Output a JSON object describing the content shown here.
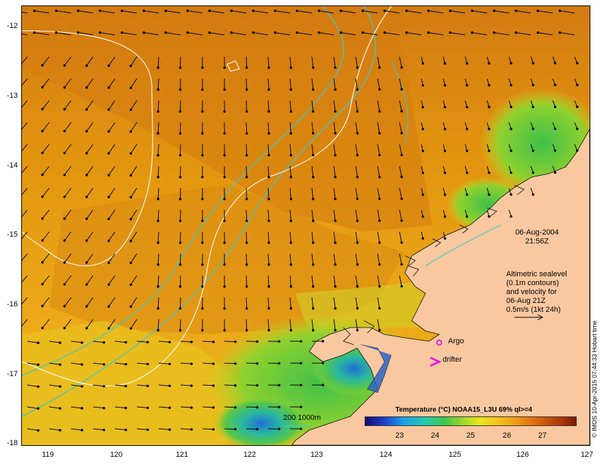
{
  "map": {
    "date": "06-Aug-2004",
    "time": "21:56Z",
    "info_lines": [
      "Altimetric sealevel",
      "(0.1m contours)",
      "and velocity for",
      "06-Aug 21Z",
      "0.5m/s (1kt 24h)"
    ],
    "lat_labels": [
      "-12",
      "-13",
      "-14",
      "-15",
      "-16",
      "-17",
      "-18"
    ],
    "lon_labels": [
      "119",
      "120",
      "121",
      "122",
      "123",
      "124",
      "125",
      "126",
      "127"
    ],
    "argo_label": "Argo",
    "drifter_label": "drifter",
    "depth_contours_label": "200  1000m",
    "copyright": "© IMOS 10-Apr-2015 07:44:33 Hobart time"
  },
  "legend": {
    "title": "Temperature (°C) NOAA15_L3U 69% ql>=4",
    "ticks": [
      "23",
      "24",
      "25",
      "26",
      "27"
    ]
  },
  "colors": {
    "land": "#f9c8a0",
    "warm_sea": "#dd8a14",
    "mid_sea": "#e9a616",
    "cool_sea": "#4cc24a",
    "depth_contour": "#3fc8c8",
    "sealevel_contour": "#ffffff",
    "argo_marker": "#e020e0"
  }
}
